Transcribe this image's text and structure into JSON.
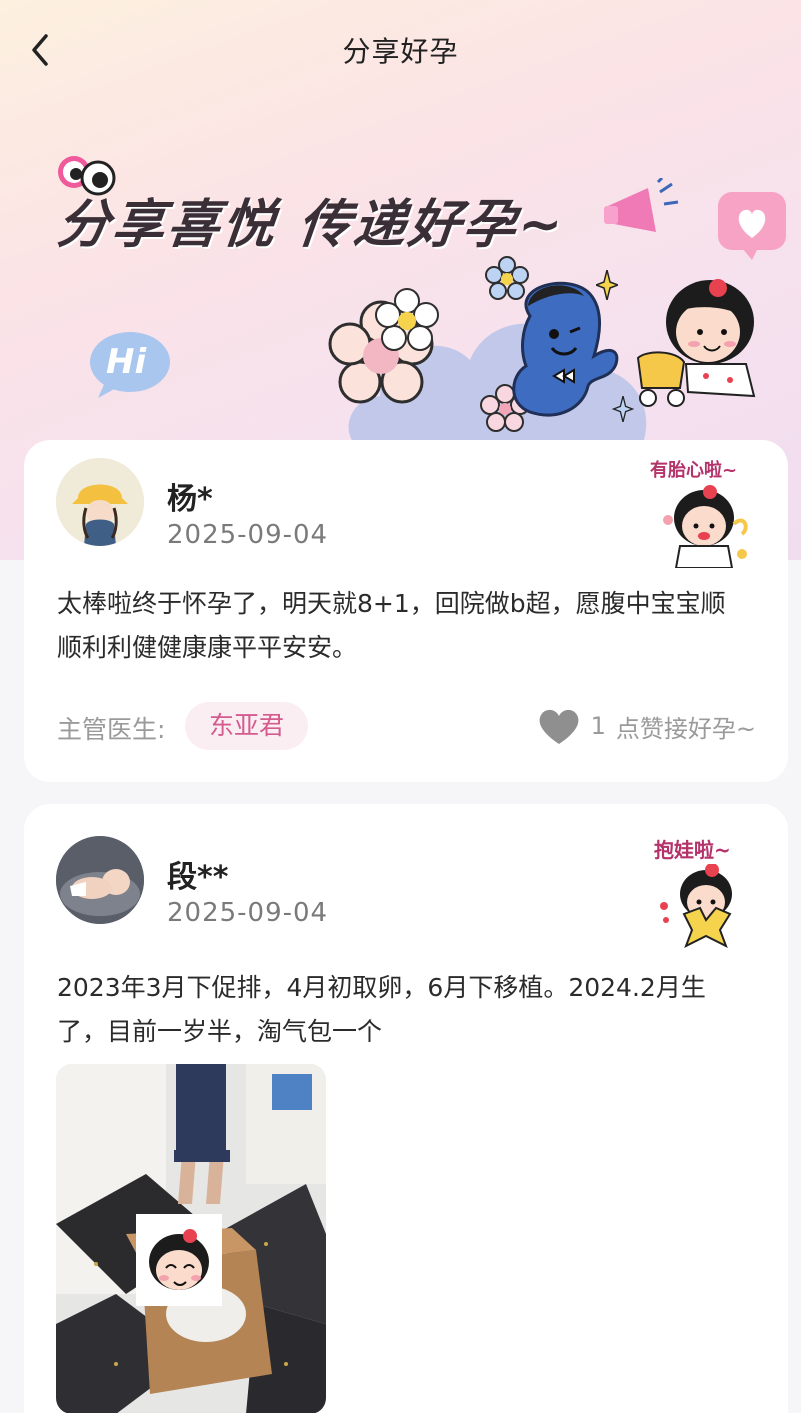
{
  "header": {
    "title": "分享好孕",
    "back_icon": "chevron-left-icon"
  },
  "banner": {
    "slogan": "分享喜悦 传递好孕~",
    "hi_bubble": "Hi"
  },
  "posts": [
    {
      "user": "杨*",
      "date": "2025-09-04",
      "sticker_text": "有胎心啦~",
      "content": "太棒啦终于怀孕了，明天就8+1，回院做b超，愿腹中宝宝顺顺利利健健康康平平安安。",
      "doctor_label": "主管医生:",
      "doctor_name": "东亚君",
      "like_count": "1",
      "like_text": "点赞接好孕~"
    },
    {
      "user": "段**",
      "date": "2025-09-04",
      "sticker_text": "抱娃啦~",
      "content": "2023年3月下促排，4月初取卵，6月下移植。2024.2月生了，目前一岁半，淘气包一个"
    }
  ],
  "colors": {
    "accent_pink": "#d45b8e",
    "tag_bg": "#fbeef3",
    "hero_gradient_start": "#fdf0df",
    "hero_gradient_end": "#f0ddee"
  }
}
